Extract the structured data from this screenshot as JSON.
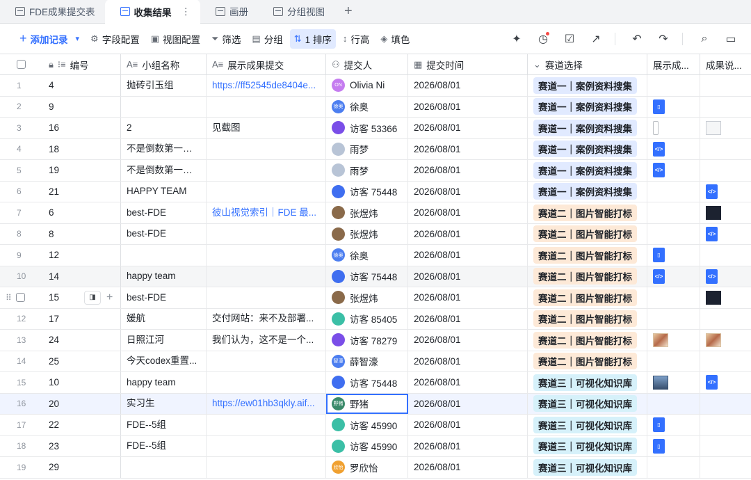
{
  "tabs": [
    {
      "label": "FDE成果提交表",
      "active": false
    },
    {
      "label": "收集结果",
      "active": true
    },
    {
      "label": "画册",
      "active": false
    },
    {
      "label": "分组视图",
      "active": false
    }
  ],
  "tab_more": "⋮",
  "add_tab": "+",
  "toolbar": {
    "add_record": "添加记录",
    "field_config": "字段配置",
    "view_config": "视图配置",
    "filter": "筛选",
    "group": "分组",
    "sort": "1 排序",
    "row_height": "行高",
    "fill": "填色"
  },
  "colors": {
    "accent": "#3370ff",
    "tag_track1": "#e1eaff",
    "tag_track2": "#fde9d7",
    "tag_track3": "#d6f1fa"
  },
  "columns": [
    "编号",
    "小组名称",
    "展示成果提交",
    "提交人",
    "提交时间",
    "赛道选择",
    "展示成...",
    "成果说..."
  ],
  "rows": [
    {
      "n": "1",
      "id": "4",
      "group": "抛砖引玉组",
      "show": "https://ff52545de8404e...",
      "link": true,
      "who": "Olivia Ni",
      "av": "ON",
      "avc": "#c57cf0",
      "time": "2026/08/01",
      "track": "赛道一｜案例资料搜集",
      "t": 1,
      "a1": "",
      "a2": ""
    },
    {
      "n": "2",
      "id": "9",
      "group": "",
      "show": "",
      "link": false,
      "who": "徐奥",
      "av": "徐奥",
      "avc": "#4c7ef0",
      "time": "2026/08/01",
      "track": "赛道一｜案例资料搜集",
      "t": 1,
      "a1": "doc",
      "a2": ""
    },
    {
      "n": "3",
      "id": "16",
      "group": "2",
      "show": "见截图",
      "link": false,
      "who": "访客 53366",
      "av": "",
      "avc": "#7a4ee8",
      "time": "2026/08/01",
      "track": "赛道一｜案例资料搜集",
      "t": 1,
      "a1": "phone",
      "a2": "thumb"
    },
    {
      "n": "4",
      "id": "18",
      "group": "不是倒数第一就行",
      "show": "",
      "link": false,
      "who": "雨梦",
      "av": "",
      "avc": "#b8c4d6",
      "time": "2026/08/01",
      "track": "赛道一｜案例资料搜集",
      "t": 1,
      "a1": "code",
      "a2": ""
    },
    {
      "n": "5",
      "id": "19",
      "group": "不是倒数第一就行",
      "show": "",
      "link": false,
      "who": "雨梦",
      "av": "",
      "avc": "#b8c4d6",
      "time": "2026/08/01",
      "track": "赛道一｜案例资料搜集",
      "t": 1,
      "a1": "code",
      "a2": ""
    },
    {
      "n": "6",
      "id": "21",
      "group": "HAPPY TEAM",
      "show": "",
      "link": false,
      "who": "访客 75448",
      "av": "",
      "avc": "#3f6ef0",
      "time": "2026/08/01",
      "track": "赛道一｜案例资料搜集",
      "t": 1,
      "a1": "",
      "a2": "code"
    },
    {
      "n": "7",
      "id": "6",
      "group": "best-FDE",
      "show": "彼山视觉索引｜FDE 最...",
      "link": true,
      "who": "张煜炜",
      "av": "",
      "avc": "#8a6a4a",
      "time": "2026/08/01",
      "track": "赛道二｜图片智能打标",
      "t": 2,
      "a1": "",
      "a2": "dark"
    },
    {
      "n": "8",
      "id": "8",
      "group": "best-FDE",
      "show": "",
      "link": false,
      "who": "张煜炜",
      "av": "",
      "avc": "#8a6a4a",
      "time": "2026/08/01",
      "track": "赛道二｜图片智能打标",
      "t": 2,
      "a1": "",
      "a2": "code"
    },
    {
      "n": "9",
      "id": "12",
      "group": "",
      "show": "",
      "link": false,
      "who": "徐奥",
      "av": "徐奥",
      "avc": "#4c7ef0",
      "time": "2026/08/01",
      "track": "赛道二｜图片智能打标",
      "t": 2,
      "a1": "doc",
      "a2": ""
    },
    {
      "n": "10",
      "id": "14",
      "group": "happy team",
      "show": "",
      "link": false,
      "who": "访客 75448",
      "av": "",
      "avc": "#3f6ef0",
      "time": "2026/08/01",
      "track": "赛道二｜图片智能打标",
      "t": 2,
      "a1": "code",
      "a2": "code",
      "hl": true
    },
    {
      "n": "",
      "id": "15",
      "group": "best-FDE",
      "show": "",
      "link": false,
      "who": "张煜炜",
      "av": "",
      "avc": "#8a6a4a",
      "time": "2026/08/01",
      "track": "赛道二｜图片智能打标",
      "t": 2,
      "a1": "",
      "a2": "dark",
      "hover": true
    },
    {
      "n": "12",
      "id": "17",
      "group": "媛航",
      "show": "交付网站：来不及部署...",
      "link": false,
      "who": "访客 85405",
      "av": "",
      "avc": "#3bbfa6",
      "time": "2026/08/01",
      "track": "赛道二｜图片智能打标",
      "t": 2,
      "a1": "",
      "a2": ""
    },
    {
      "n": "13",
      "id": "24",
      "group": "日照江河",
      "show": "我们认为，这不是一个...",
      "link": false,
      "who": "访客 78279",
      "av": "",
      "avc": "#7a4ee8",
      "time": "2026/08/01",
      "track": "赛道二｜图片智能打标",
      "t": 2,
      "a1": "art",
      "a2": "art"
    },
    {
      "n": "14",
      "id": "25",
      "group": "今天codex重置...",
      "show": "",
      "link": false,
      "who": "薛智濠",
      "av": "智濠",
      "avc": "#4c7ef0",
      "time": "2026/08/01",
      "track": "赛道二｜图片智能打标",
      "t": 2,
      "a1": "",
      "a2": ""
    },
    {
      "n": "15",
      "id": "10",
      "group": "happy team",
      "show": "",
      "link": false,
      "who": "访客 75448",
      "av": "",
      "avc": "#3f6ef0",
      "time": "2026/08/01",
      "track": "赛道三｜可视化知识库",
      "t": 3,
      "a1": "city",
      "a2": "code"
    },
    {
      "n": "16",
      "id": "20",
      "group": "实习生",
      "show": "https://ew01hb3qkly.aif...",
      "link": true,
      "who": "野猪",
      "av": "野猪",
      "avc": "#3a8a6a",
      "time": "2026/08/01",
      "track": "赛道三｜可视化知识库",
      "t": 3,
      "a1": "",
      "a2": "",
      "sel": true
    },
    {
      "n": "17",
      "id": "22",
      "group": "FDE--5组",
      "show": "",
      "link": false,
      "who": "访客 45990",
      "av": "",
      "avc": "#3bbfa6",
      "time": "2026/08/01",
      "track": "赛道三｜可视化知识库",
      "t": 3,
      "a1": "doc",
      "a2": ""
    },
    {
      "n": "18",
      "id": "23",
      "group": "FDE--5组",
      "show": "",
      "link": false,
      "who": "访客 45990",
      "av": "",
      "avc": "#3bbfa6",
      "time": "2026/08/01",
      "track": "赛道三｜可视化知识库",
      "t": 3,
      "a1": "doc",
      "a2": ""
    },
    {
      "n": "19",
      "id": "29",
      "group": "",
      "show": "",
      "link": false,
      "who": "罗欣怡",
      "av": "欣怡",
      "avc": "#f0a030",
      "time": "2026/08/01",
      "track": "赛道三｜可视化知识库",
      "t": 3,
      "a1": "",
      "a2": ""
    }
  ]
}
